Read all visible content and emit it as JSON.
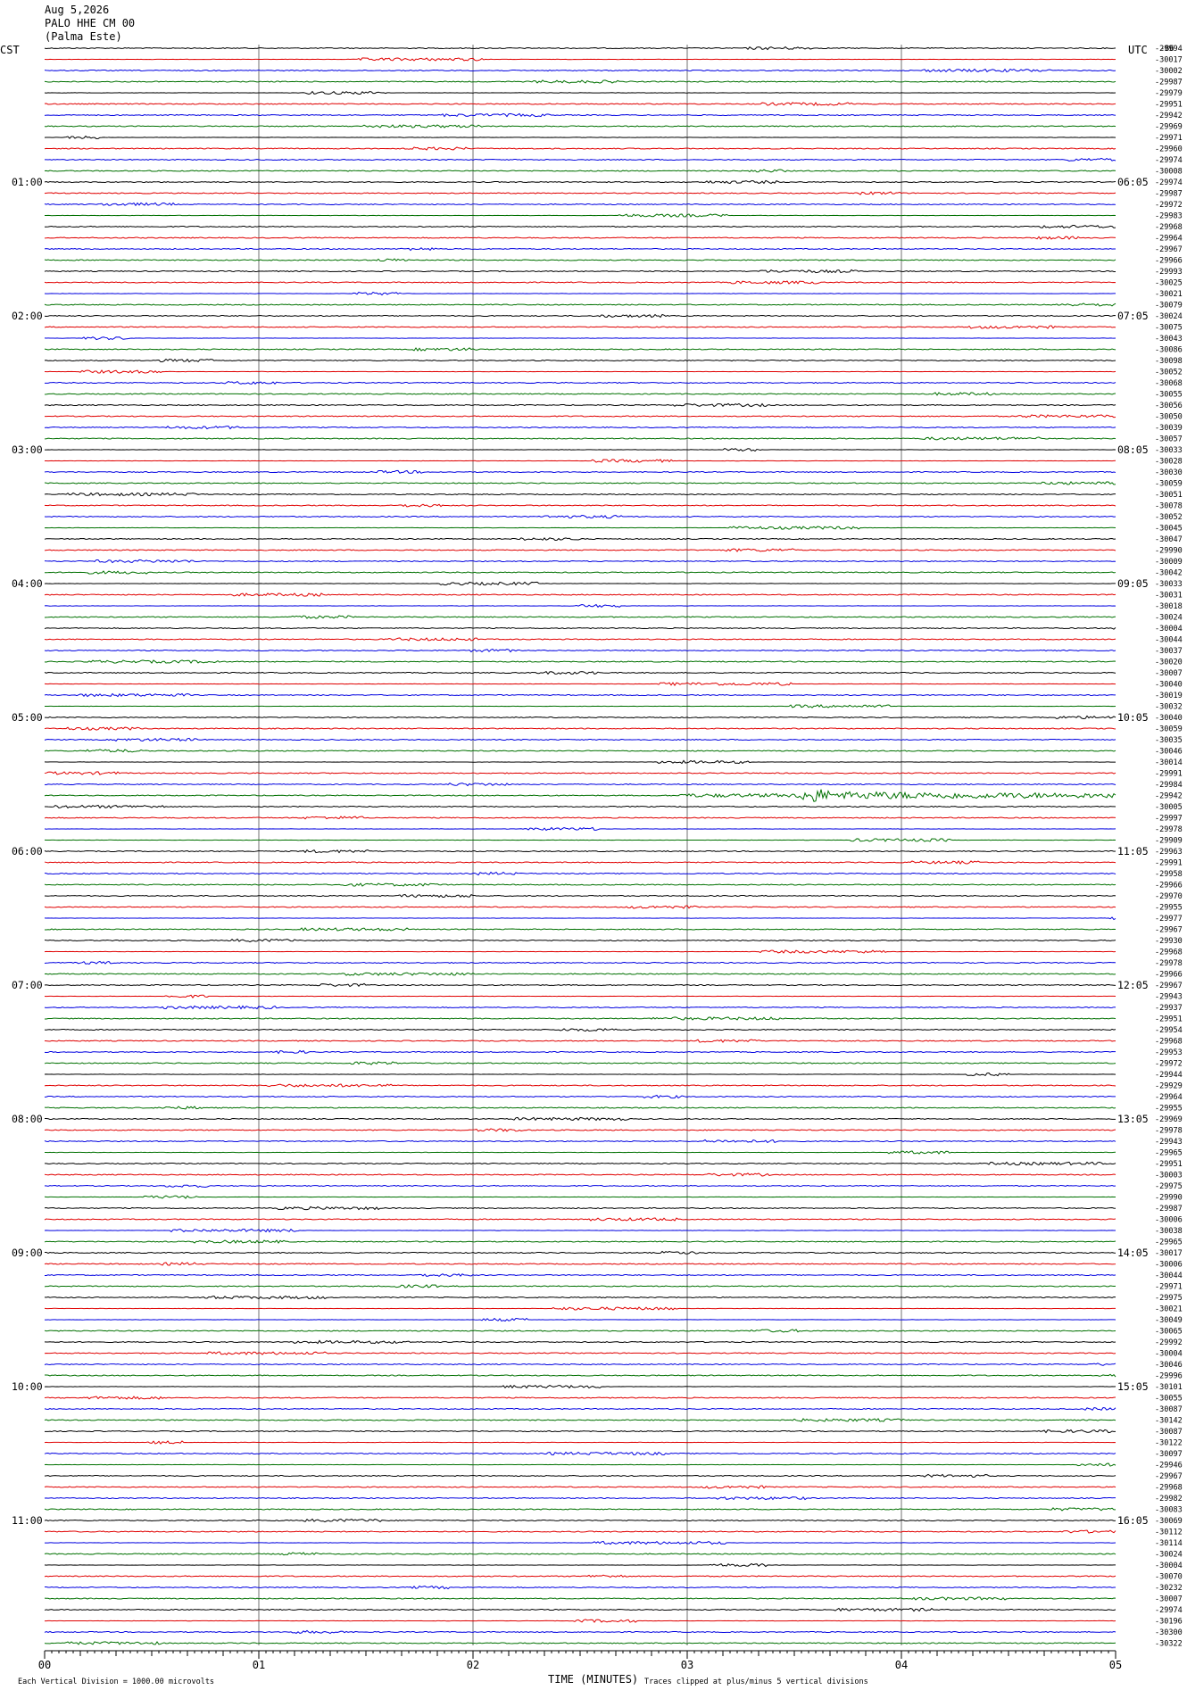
{
  "header": {
    "date": "Aug 5,2026",
    "station": "PALO HHE CM 00",
    "site": "(Palma Este)"
  },
  "tz_left": "CST",
  "tz_right": "UTC",
  "chart_data": {
    "type": "helicorder",
    "title": "",
    "xlabel": "TIME (MINUTES)",
    "x_ticks": [
      "00",
      "01",
      "02",
      "03",
      "04",
      "05"
    ],
    "xlim": [
      0,
      5
    ],
    "left_hour_labels": [
      "01:00",
      "02:00",
      "03:00",
      "04:00",
      "05:00",
      "06:00",
      "07:00",
      "08:00",
      "09:00",
      "10:00",
      "11:00"
    ],
    "right_hour_labels": [
      "06:05",
      "07:05",
      "08:05",
      "09:05",
      "10:05",
      "11:05",
      "12:05",
      "13:05",
      "14:05",
      "15:05",
      "16:05"
    ],
    "trace_colors": [
      "#000000",
      "#e00000",
      "#0000e0",
      "#007000"
    ],
    "top_value": "-86",
    "trace_offsets": [
      -29994,
      -30017,
      -30002,
      -29987,
      -29979,
      -29951,
      -29942,
      -29969,
      -29971,
      -29960,
      -29974,
      -30008,
      -29974,
      -29987,
      -29972,
      -29983,
      -29968,
      -29964,
      -29967,
      -29966,
      -29993,
      -30025,
      -30021,
      -30079,
      -30024,
      -30075,
      -30043,
      -30086,
      -30098,
      -30052,
      -30068,
      -30055,
      -30056,
      -30050,
      -30039,
      -30057,
      -30033,
      -30028,
      -30030,
      -30059,
      -30051,
      -30078,
      -30052,
      -30045,
      -30047,
      -29990,
      -30009,
      -30042,
      -30033,
      -30031,
      -30018,
      -30024,
      -30004,
      -30044,
      -30037,
      -30020,
      -30007,
      -30040,
      -30019,
      -30032,
      -30040,
      -30059,
      -30035,
      -30046,
      -30014,
      -29991,
      -29984,
      -29942,
      -30005,
      -29997,
      -29978,
      -29909,
      -29963,
      -29991,
      -29958,
      -29966,
      -29970,
      -29955,
      -29977,
      -29967,
      -29930,
      -29968,
      -29978,
      -29966,
      -29967,
      -29943,
      -29937,
      -29951,
      -29954,
      -29968,
      -29953,
      -29972,
      -29944,
      -29929,
      -29964,
      -29955,
      -29969,
      -29978,
      -29943,
      -29965,
      -29951,
      -30003,
      -29975,
      -29990,
      -29987,
      -30006,
      -30038,
      -29965,
      -30017,
      -30006,
      -30044,
      -29971,
      -29975,
      -30021,
      -30049,
      -30065,
      -29992,
      -30004,
      -30046,
      -29996,
      -30101,
      -30055,
      -30087,
      -30142,
      -30087,
      -30122,
      -30097,
      -29946,
      -29967,
      -29968,
      -29982,
      -30083,
      -30069,
      -30112,
      -30114,
      -30024,
      -30004,
      -30070,
      -30232,
      -30007,
      -29974,
      -30196,
      -30300,
      -30322
    ],
    "event": {
      "trace_index": 67,
      "minute_start": 2.95,
      "minute_peak": 3.6
    }
  },
  "footer": {
    "scale_note": "Each Vertical Division = 1000.00 microvolts",
    "clip_note": "Traces clipped at plus/minus 5 vertical divisions"
  }
}
